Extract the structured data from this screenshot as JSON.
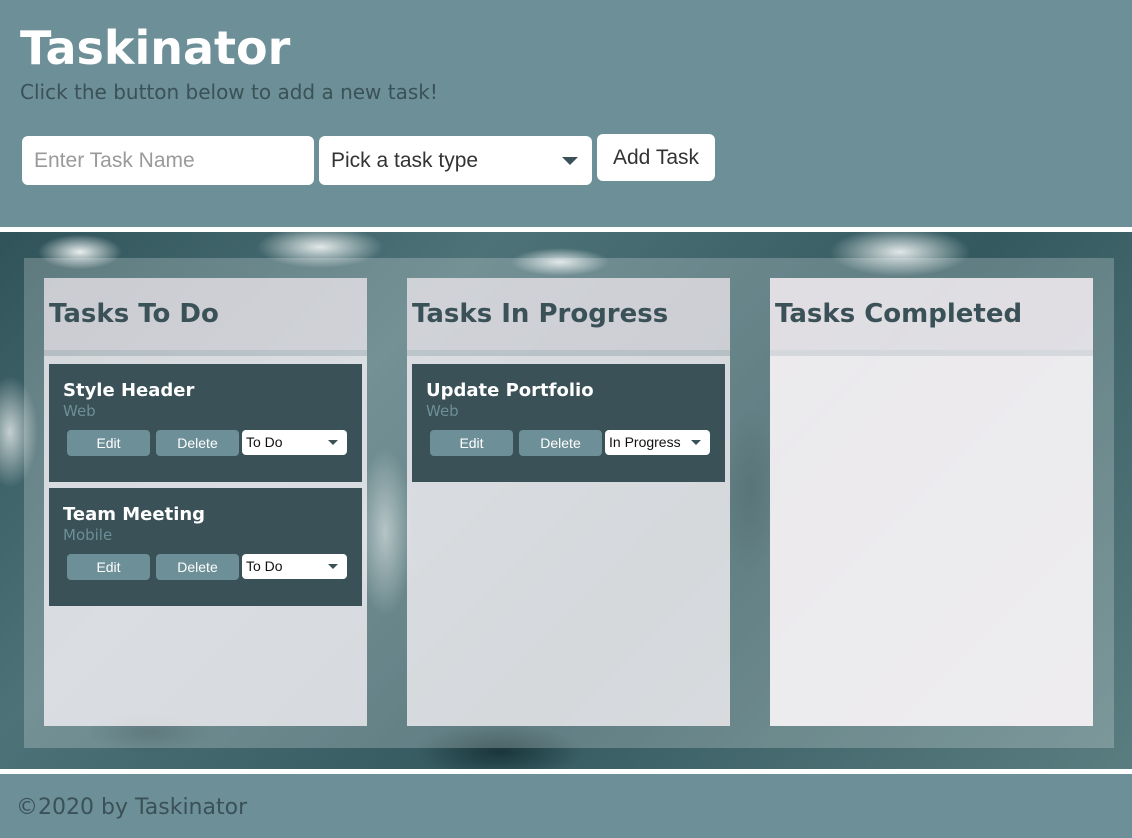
{
  "header": {
    "title": "Taskinator",
    "subtitle": "Click the button below to add a new task!",
    "form": {
      "task_name_placeholder": "Enter Task Name",
      "task_name_value": "",
      "task_type_selected": "Pick a task type",
      "add_button_label": "Add Task"
    }
  },
  "columns": [
    {
      "title": "Tasks To Do",
      "tasks": [
        {
          "name": "Style Header",
          "type": "Web",
          "status": "To Do"
        },
        {
          "name": "Team Meeting",
          "type": "Mobile",
          "status": "To Do"
        }
      ]
    },
    {
      "title": "Tasks In Progress",
      "tasks": [
        {
          "name": "Update Portfolio",
          "type": "Web",
          "status": "In Progress"
        }
      ]
    },
    {
      "title": "Tasks Completed",
      "tasks": []
    }
  ],
  "task_actions": {
    "edit_label": "Edit",
    "delete_label": "Delete"
  },
  "footer": {
    "text": "©2020 by Taskinator"
  },
  "colors": {
    "header_bg": "#6d8f97",
    "card_bg": "#3a5157",
    "button_bg": "#6d8f97",
    "text_dark": "#3a5157"
  },
  "icons": {
    "select_caret": "chevron-down-icon"
  }
}
